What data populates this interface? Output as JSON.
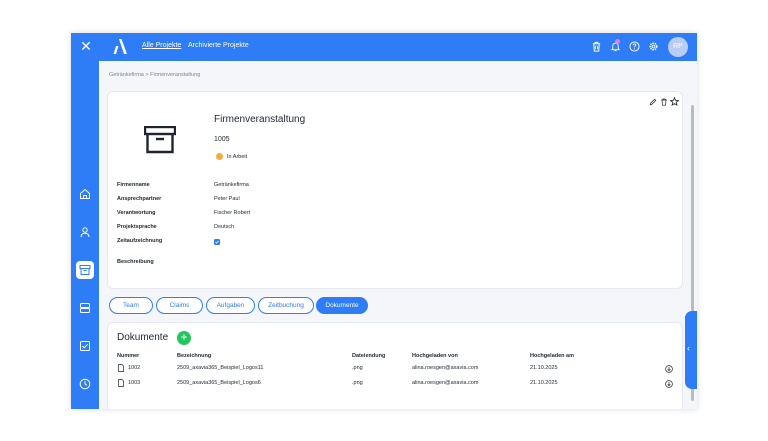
{
  "topbar": {
    "nav_all_projects": "Alle Projekte",
    "nav_archived": "Archivierte Projekte",
    "avatar_initials": "RP",
    "icons": [
      "close-icon",
      "logo-icon",
      "trash-icon",
      "bell-icon",
      "help-icon",
      "gear-icon"
    ]
  },
  "sidebar": {
    "items": [
      "home-icon",
      "user-icon",
      "archive-icon",
      "database-icon",
      "checkbox-icon",
      "clock-icon"
    ],
    "active": "archive-icon"
  },
  "breadcrumb": "Getränkefirma > Firmenveranstaltung",
  "project": {
    "title": "Firmenveranstaltung",
    "number": "1005",
    "status": "In Arbeit",
    "status_color": "#f7a93a",
    "fields": [
      {
        "label": "Firmenname",
        "value": "Getränkefirma"
      },
      {
        "label": "Ansprechpartner",
        "value": "Peter Paul"
      },
      {
        "label": "Verantwortung",
        "value": "Fischer Robert"
      },
      {
        "label": "Projektsprache",
        "value": "Deutsch"
      },
      {
        "label": "Zeitaufzeichnung",
        "value": ""
      },
      {
        "label": "Beschreibung",
        "value": ""
      }
    ],
    "zeitaufzeichnung_checked": true
  },
  "tabs": [
    {
      "label": "Team"
    },
    {
      "label": "Claims"
    },
    {
      "label": "Aufgaben"
    },
    {
      "label": "Zeitbuchung"
    },
    {
      "label": "Dokumente"
    }
  ],
  "active_tab": "Dokumente",
  "documents": {
    "title": "Dokumente",
    "add_label": "+",
    "columns": [
      "Nummer",
      "Bezeichnung",
      "Dateiendung",
      "Hochgeladen von",
      "Hochgeladen am"
    ],
    "rows": [
      [
        "1002",
        "2509_axavia365_Beispiel_Logos11",
        ".png",
        "alina.roesgen@axavia.com",
        "21.10.2025"
      ],
      [
        "1003",
        "2509_axavia365_Beispiel_Logos6",
        ".png",
        "alina.roesgen@axavia.com",
        "21.10.2025"
      ]
    ]
  },
  "colors": {
    "accent": "#2f7df6",
    "add_button": "#22c55e",
    "background": "#f4f6fa"
  }
}
